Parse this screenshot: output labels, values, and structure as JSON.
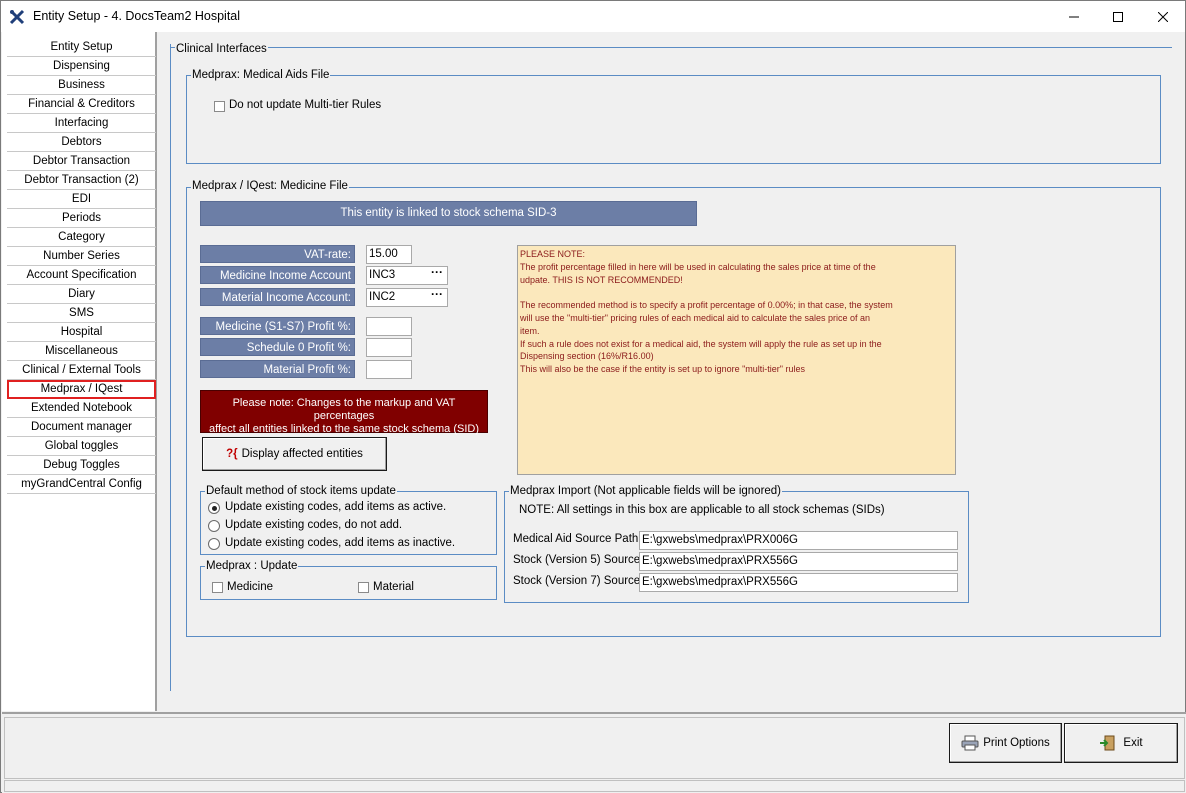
{
  "window": {
    "title": "Entity Setup - 4. DocsTeam2 Hospital",
    "app_icon": "cross-tools-icon"
  },
  "sidebar": {
    "items": [
      {
        "label": "Entity Setup"
      },
      {
        "label": "Dispensing"
      },
      {
        "label": "Business"
      },
      {
        "label": "Financial & Creditors"
      },
      {
        "label": "Interfacing"
      },
      {
        "label": "Debtors"
      },
      {
        "label": "Debtor Transaction"
      },
      {
        "label": "Debtor Transaction (2)"
      },
      {
        "label": "EDI"
      },
      {
        "label": "Periods"
      },
      {
        "label": "Category"
      },
      {
        "label": "Number Series"
      },
      {
        "label": "Account Specification"
      },
      {
        "label": "Diary"
      },
      {
        "label": "SMS"
      },
      {
        "label": "Hospital"
      },
      {
        "label": "Miscellaneous"
      },
      {
        "label": "Clinical / External Tools"
      },
      {
        "label": "Medprax / IQest",
        "active": true
      },
      {
        "label": "Extended Notebook"
      },
      {
        "label": "Document manager"
      },
      {
        "label": "Global toggles"
      },
      {
        "label": "Debug Toggles"
      },
      {
        "label": "myGrandCentral Config"
      }
    ]
  },
  "main": {
    "section_title": "Clinical Interfaces",
    "medical_aids": {
      "legend": "Medprax: Medical Aids File",
      "checkbox_label": "Do not update Multi-tier Rules",
      "checked": false
    },
    "medicine_file": {
      "legend": "Medprax / IQest: Medicine File",
      "banner": "This entity is linked to stock schema  SID-3",
      "vat_label": "VAT-rate:",
      "vat_value": "15.00",
      "medicine_income_label": "Medicine Income Account",
      "medicine_income_value": "INC3",
      "material_income_label": "Material Income Account:",
      "material_income_value": "INC2",
      "dots": "···",
      "medicine_profit_label": "Medicine (S1-S7) Profit %:",
      "medicine_profit_value": "",
      "schedule0_profit_label": "Schedule 0 Profit %:",
      "schedule0_profit_value": "",
      "material_profit_label": "Material Profit %:",
      "material_profit_value": "",
      "warning_line1": "Please note: Changes to the markup and VAT percentages",
      "warning_line2": "affect all entities linked to the same stock schema (SID)",
      "display_button_label": "Display affected entities",
      "display_button_icon": "?{",
      "note_lines": [
        "PLEASE NOTE:",
        "The profit percentage filled in here will be used in calculating the sales price at time of the",
        "udpate. THIS IS NOT RECOMMENDED!",
        "",
        "The recommended method is to specify a profit percentage of 0.00%; in that case, the system",
        "will use the \"multi-tier\" pricing rules of each medical aid to calculate the sales price of an",
        "item.",
        "If such a rule does not exist for a medical aid, the system will apply the rule as set up in the",
        "Dispensing section (16%/R16.00)",
        "This will also be the case if the entity is set up to ignore \"multi-tier\" rules"
      ]
    },
    "default_method": {
      "legend": "Default method of stock items update",
      "options": [
        {
          "label": "Update existing codes, add items as active.",
          "selected": true
        },
        {
          "label": "Update existing codes, do not add.",
          "selected": false
        },
        {
          "label": "Update existing codes, add items as inactive.",
          "selected": false
        }
      ]
    },
    "medprax_update": {
      "legend": "Medprax : Update",
      "medicine_label": "Medicine",
      "material_label": "Material"
    },
    "medprax_import": {
      "legend": "Medprax Import  (Not applicable fields will be ignored)",
      "note": "NOTE:  All settings in this box are applicable to all stock schemas (SIDs)",
      "rows": [
        {
          "label": "Medical Aid Source Path",
          "value": "E:\\gxwebs\\medprax\\PRX006G"
        },
        {
          "label": "Stock (Version 5) Source",
          "value": "E:\\gxwebs\\medprax\\PRX556G"
        },
        {
          "label": "Stock (Version 7) Source",
          "value": "E:\\gxwebs\\medprax\\PRX556G"
        }
      ]
    }
  },
  "footer": {
    "print_label": "Print Options",
    "exit_label": "Exit"
  },
  "colors": {
    "accent_border": "#5b8cc4",
    "label_bg": "#6c7ea6",
    "warning_bg": "#800000",
    "note_bg": "#fbe8bc",
    "note_text": "#8b1a1a",
    "active_nav_border": "#e02020"
  }
}
